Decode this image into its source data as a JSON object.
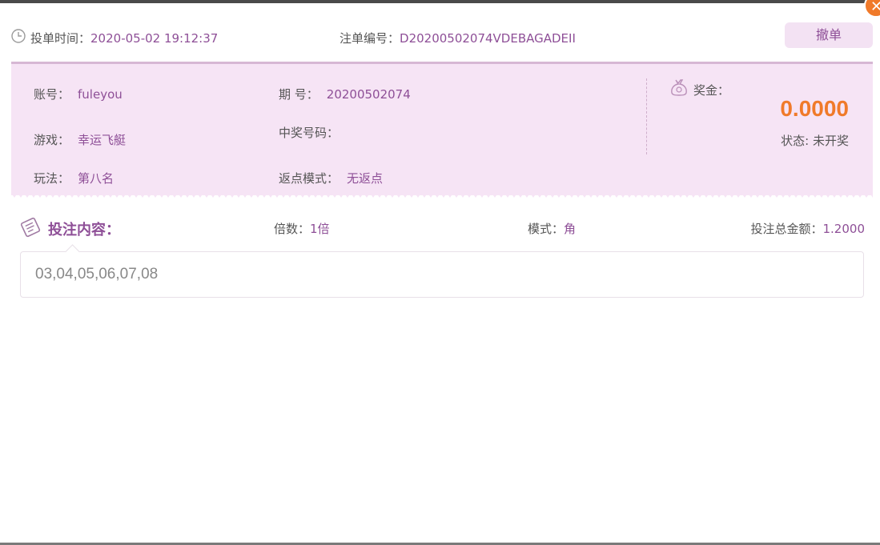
{
  "dialog": {
    "close_symbol": "✕"
  },
  "header": {
    "bet_time_label": "投单时间：",
    "bet_time_value": "2020-05-02 19:12:37",
    "order_no_label": "注单编号：",
    "order_no_value": "D20200502074VDEBAGADEII",
    "cancel_label": "撤单"
  },
  "info": {
    "account_label": "账号：",
    "account_value": "fuleyou",
    "issue_label": "期  号：",
    "issue_value": "20200502074",
    "game_label": "游戏：",
    "game_value": "幸运飞艇",
    "winning_no_label": "中奖号码：",
    "winning_no_value": "",
    "play_label": "玩法：",
    "play_value": "第八名",
    "rebate_label": "返点模式：",
    "rebate_value": "无返点",
    "prize_label": "奖金：",
    "prize_value": "0.0000",
    "status_label": "状态: ",
    "status_value": "未开奖"
  },
  "bet": {
    "title": "投注内容：",
    "multiple_label": "倍数：",
    "multiple_value": "1倍",
    "mode_label": "模式：",
    "mode_value": "角",
    "total_label": "投注总金额：",
    "total_value": "1.2000",
    "numbers": "03,04,05,06,07,08"
  },
  "colors": {
    "accent": "#8e4f97",
    "panel_bg": "#f6e4f5",
    "prize": "#f07a2a"
  }
}
